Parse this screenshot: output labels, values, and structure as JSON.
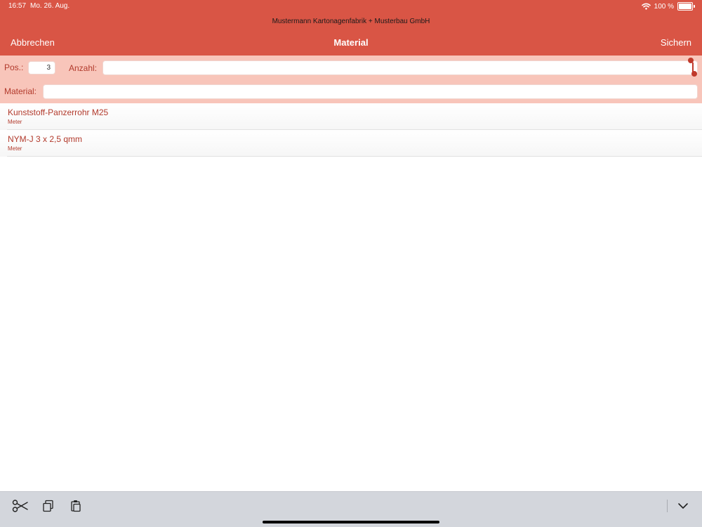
{
  "status_bar": {
    "time": "16:57",
    "date": "Mo. 26. Aug.",
    "battery": "100 %"
  },
  "window_title": "Mustermann Kartonagenfabrik + Musterbau GmbH",
  "nav": {
    "cancel_label": "Abbrechen",
    "title": "Material",
    "save_label": "Sichern"
  },
  "form": {
    "pos_label": "Pos.:",
    "pos_value": "3",
    "anzahl_label": "Anzahl:",
    "anzahl_value": "",
    "material_label": "Material:",
    "material_value": ""
  },
  "materials": [
    {
      "name": "Kunststoff-Panzerrohr M25",
      "unit": "Meter"
    },
    {
      "name": "NYM-J 3 x 2,5 qmm",
      "unit": "Meter"
    }
  ],
  "shortcut_bar": {
    "icons": [
      "scissors-icon",
      "copy-icon",
      "paste-icon",
      "chevron-down-icon"
    ]
  },
  "colors": {
    "header": "#d95545",
    "form_background": "#f8c5ba",
    "accent_text": "#b23a2c",
    "toolbar": "#d3d6dc"
  }
}
